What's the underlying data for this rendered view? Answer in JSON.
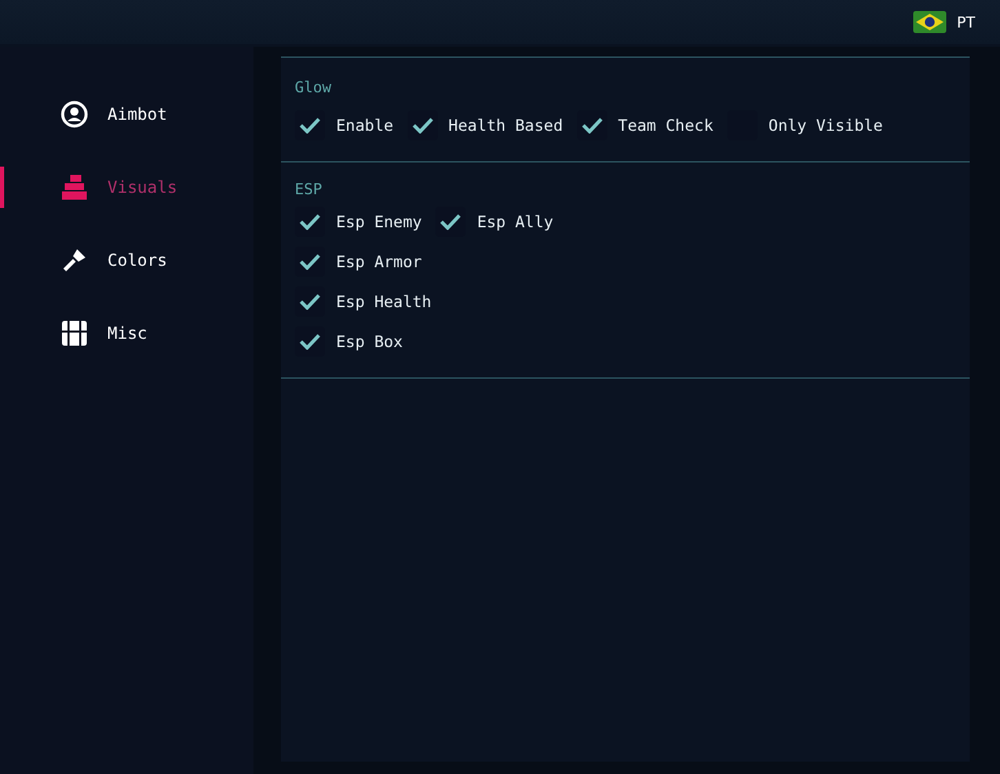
{
  "topbar": {
    "language": "PT"
  },
  "sidebar": {
    "items": [
      {
        "label": "Aimbot",
        "kind": "aimbot",
        "selected": false
      },
      {
        "label": "Visuals",
        "kind": "visuals",
        "selected": true
      },
      {
        "label": "Colors",
        "kind": "colors",
        "selected": false
      },
      {
        "label": "Misc",
        "kind": "misc",
        "selected": false
      }
    ]
  },
  "sections": [
    {
      "title": "Glow",
      "rows": [
        [
          {
            "label": "Enable",
            "checked": true
          },
          {
            "label": "Health Based",
            "checked": true
          },
          {
            "label": "Team Check",
            "checked": true
          },
          {
            "label": "Only Visible",
            "checked": false
          }
        ]
      ]
    },
    {
      "title": "ESP",
      "rows": [
        [
          {
            "label": "Esp Enemy",
            "checked": true
          },
          {
            "label": "Esp Ally",
            "checked": true
          }
        ],
        [
          {
            "label": "Esp Armor",
            "checked": true
          }
        ],
        [
          {
            "label": "Esp Health",
            "checked": true
          }
        ],
        [
          {
            "label": "Esp Box",
            "checked": true
          }
        ]
      ]
    }
  ]
}
